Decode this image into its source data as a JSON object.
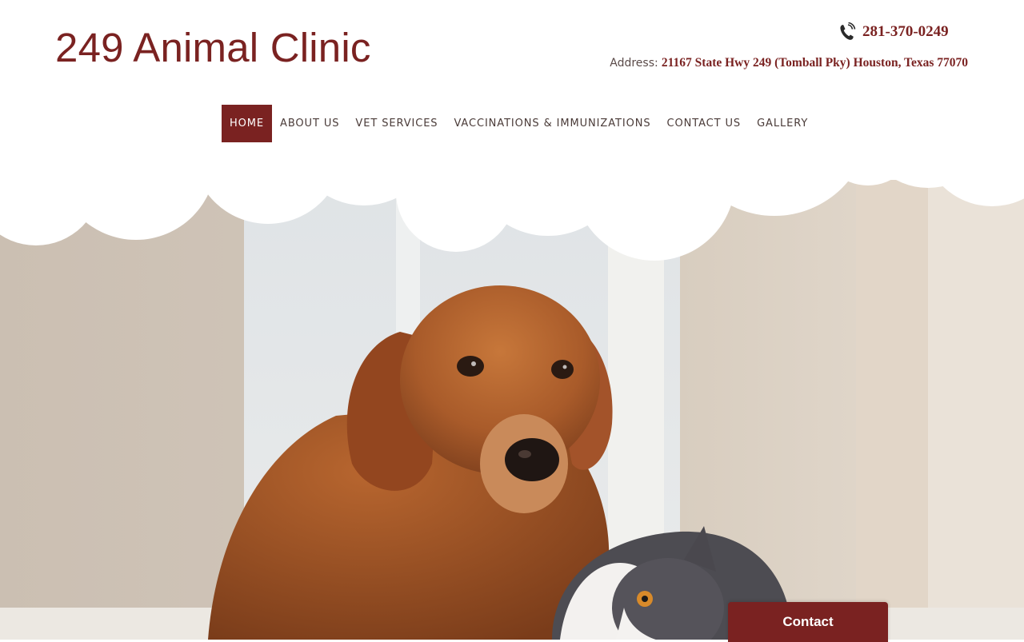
{
  "site": {
    "logo_text": "249 Animal Clinic",
    "phone": "281-370-0249",
    "phone_icon": "phone-ringing-icon",
    "address_label": "Address:",
    "address_value": "21167 State Hwy 249 (Tomball Pky) Houston, Texas 77070"
  },
  "nav": {
    "items": [
      {
        "label": "HOME",
        "active": true
      },
      {
        "label": "ABOUT US",
        "active": false
      },
      {
        "label": "VET SERVICES",
        "active": false
      },
      {
        "label": "VACCINATIONS & IMMUNIZATIONS",
        "active": false
      },
      {
        "label": "CONTACT US",
        "active": false
      },
      {
        "label": "GALLERY",
        "active": false
      }
    ]
  },
  "hero": {
    "image": "golden-retriever-and-cat-photo"
  },
  "contact_widget": {
    "label": "Contact"
  },
  "colors": {
    "brand": "#7a2221",
    "nav_text": "#4a3b38",
    "background": "#ffffff"
  }
}
